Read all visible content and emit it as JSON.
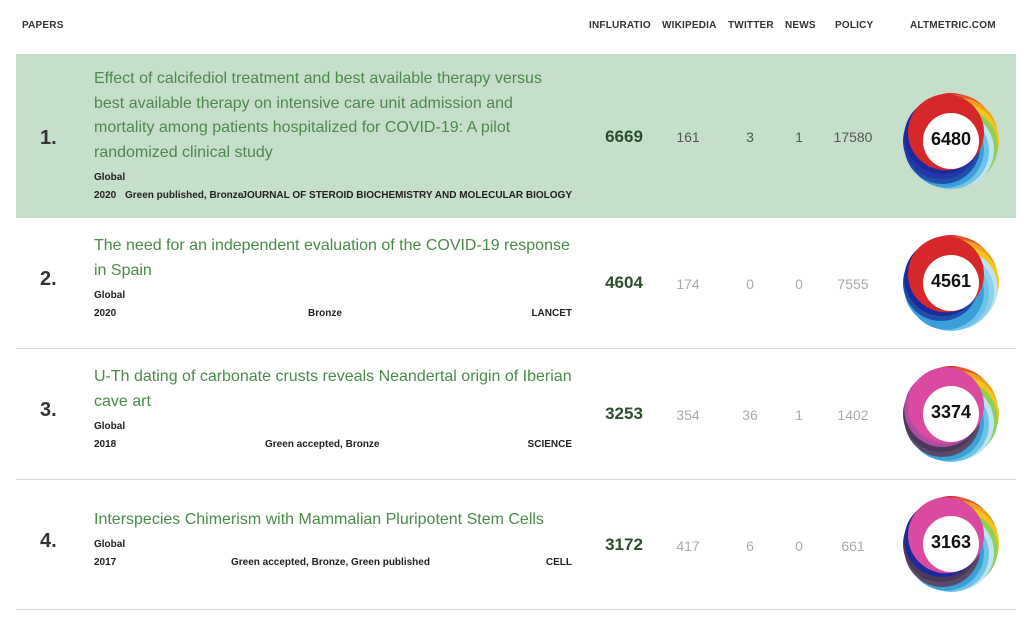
{
  "header": {
    "papers": "PAPERS",
    "influratio": "INFLURATIO",
    "wikipedia": "WIKIPEDIA",
    "twitter": "TWITTER",
    "news": "NEWS",
    "policy": "POLICY",
    "altmetric": "ALTMETRIC.COM"
  },
  "colors": {
    "highlight_row": "#c6dfca",
    "title_link": "#4a8a4a",
    "influratio": "#2d4f2d"
  },
  "rows": [
    {
      "rank": "1.",
      "title": "Effect of calcifediol treatment and best available therapy versus best available therapy on intensive care unit admission and mortality among patients hospitalized for COVID-19: A pilot randomized clinical study",
      "scope": "Global",
      "year": "2020",
      "oa": "Green published, Bronze",
      "journal": "JOURNAL OF STEROID BIOCHEMISTRY AND MOLECULAR BIOLOGY",
      "influratio": "6669",
      "wikipedia": "161",
      "twitter": "3",
      "news": "1",
      "policy": "17580",
      "altmetric": "6480"
    },
    {
      "rank": "2.",
      "title": "The need for an independent evaluation of the COVID-19 response in Spain",
      "scope": "Global",
      "year": "2020",
      "oa": "Bronze",
      "journal": "LANCET",
      "influratio": "4604",
      "wikipedia": "174",
      "twitter": "0",
      "news": "0",
      "policy": "7555",
      "altmetric": "4561"
    },
    {
      "rank": "3.",
      "title": "U-Th dating of carbonate crusts reveals Neandertal origin of Iberian cave art",
      "scope": "Global",
      "year": "2018",
      "oa": "Green accepted, Bronze",
      "journal": "SCIENCE",
      "influratio": "3253",
      "wikipedia": "354",
      "twitter": "36",
      "news": "1",
      "policy": "1402",
      "altmetric": "3374"
    },
    {
      "rank": "4.",
      "title": "Interspecies Chimerism with Mammalian Pluripotent Stem Cells",
      "scope": "Global",
      "year": "2017",
      "oa": "Green accepted, Bronze, Green published",
      "journal": "CELL",
      "influratio": "3172",
      "wikipedia": "417",
      "twitter": "6",
      "news": "0",
      "policy": "661",
      "altmetric": "3163"
    }
  ]
}
